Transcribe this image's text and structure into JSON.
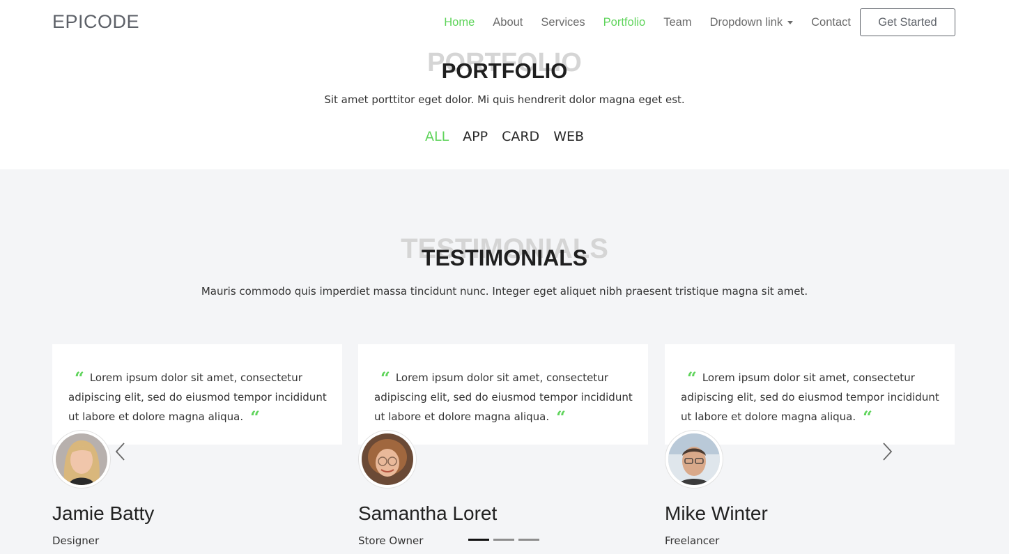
{
  "brand": {
    "logo": "EPICODE",
    "accent_color": "#5fd45b"
  },
  "nav": {
    "items": [
      {
        "label": "Home",
        "active": true
      },
      {
        "label": "About",
        "active": false
      },
      {
        "label": "Services",
        "active": false
      },
      {
        "label": "Portfolio",
        "active": true
      },
      {
        "label": "Team",
        "active": false
      },
      {
        "label": "Dropdown link",
        "active": false
      },
      {
        "label": "Contact",
        "active": false
      }
    ],
    "cta": "Get Started"
  },
  "portfolio": {
    "ghost_title": "PORTFOLIO",
    "title": "PORTFOLIO",
    "subtitle": "Sit amet porttitor eget dolor. Mi quis hendrerit dolor magna eget est.",
    "filters": [
      "ALL",
      "APP",
      "CARD",
      "WEB"
    ],
    "active_filter": "ALL"
  },
  "testimonials": {
    "ghost_title": "TESTIMONIALS",
    "title": "TESTIMONIALS",
    "subtitle": "Mauris commodo quis imperdiet massa tincidunt nunc. Integer eget aliquet nibh praesent tristique magna sit amet.",
    "items": [
      {
        "quote": "Lorem ipsum dolor sit amet, consectetur adipiscing elit, sed do eiusmod tempor incididunt ut labore et dolore magna aliqua.",
        "name": "Jamie Batty",
        "role": "Designer"
      },
      {
        "quote": "Lorem ipsum dolor sit amet, consectetur adipiscing elit, sed do eiusmod tempor incididunt ut labore et dolore magna aliqua.",
        "name": "Samantha Loret",
        "role": "Store Owner"
      },
      {
        "quote": "Lorem ipsum dolor sit amet, consectetur adipiscing elit, sed do eiusmod tempor incididunt ut labore et dolore magna aliqua.",
        "name": "Mike Winter",
        "role": "Freelancer"
      }
    ],
    "carousel": {
      "indicator_count": 3,
      "active_index": 0
    }
  }
}
